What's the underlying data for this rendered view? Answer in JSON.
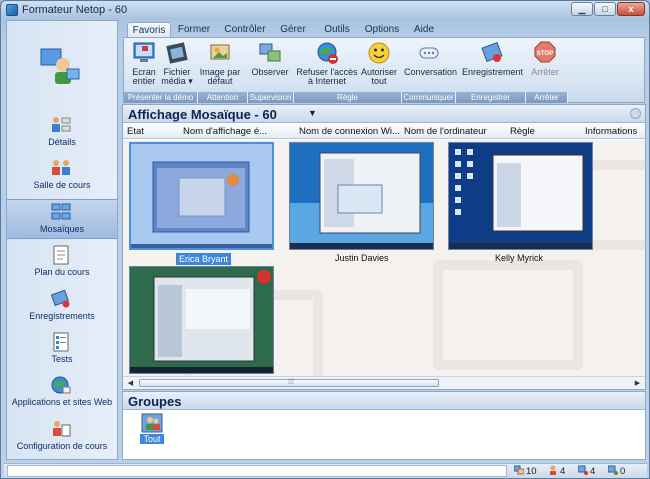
{
  "window": {
    "title": "Formateur Netop - 60"
  },
  "ribbon": {
    "tabs": [
      {
        "label": "Favoris"
      },
      {
        "label": "Former"
      },
      {
        "label": "Contrôler"
      },
      {
        "label": "Gérer"
      },
      {
        "label": "Outils"
      },
      {
        "label": "Options"
      },
      {
        "label": "Aide"
      }
    ],
    "buttons": {
      "ecran": "Ecran entier",
      "fichier": "Fichier média",
      "image": "Image par défaut",
      "observer": "Observer",
      "refuser": "Refuser l'accès à Internet",
      "autoriser": "Autoriser tout",
      "conversation": "Conversation",
      "enregistrement": "Enregistrement",
      "arreter": "Arrêter"
    },
    "groups": {
      "presenter": "Présenter la démo",
      "attention": "Attention",
      "supervision": "Supervision",
      "regle": "Règle",
      "communiquer": "Communiquer",
      "enregistrer": "Enregistrer",
      "arreter": "Arrêter"
    }
  },
  "leftnav": {
    "items": [
      {
        "label": "Détails"
      },
      {
        "label": "Salle de cours"
      },
      {
        "label": "Mosaïques"
      },
      {
        "label": "Plan du cours"
      },
      {
        "label": "Enregistrements"
      },
      {
        "label": "Tests"
      },
      {
        "label": "Applications et sites Web"
      },
      {
        "label": "Configuration de cours"
      }
    ]
  },
  "view": {
    "title": "Affichage Mosaïque - 60",
    "columns": [
      "Etat",
      "Nom d'affichage é...",
      "Nom de connexion Wi...",
      "Nom de l'ordinateur",
      "Règle",
      "Informations"
    ],
    "tiles": [
      {
        "name": "Erica Bryant"
      },
      {
        "name": "Justin Davies"
      },
      {
        "name": "Kelly Myrick"
      },
      {
        "name": ""
      }
    ]
  },
  "groups": {
    "title": "Groupes",
    "item": "Tout"
  },
  "statusbar": {
    "count1": "10",
    "count2": "4",
    "count3": "4",
    "count4": "0"
  },
  "colors": {
    "accent": "#3f86d9",
    "ribbon": "#d7e4f2",
    "frame": "#8ea9c8"
  }
}
